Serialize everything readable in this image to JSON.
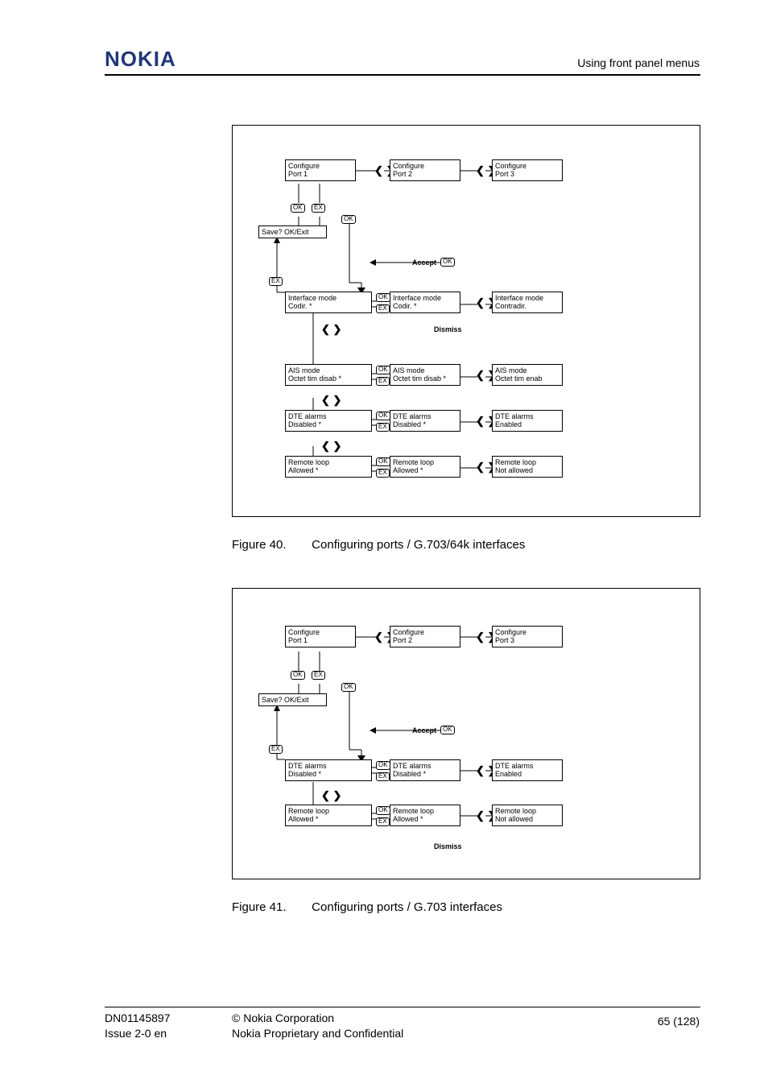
{
  "header": {
    "logo": "NOKIA",
    "section": "Using front panel menus"
  },
  "footer": {
    "doc_no": "DN01145897",
    "issue": "Issue 2-0 en",
    "copyright": "© Nokia Corporation",
    "confidential": "Nokia Proprietary and Confidential",
    "page": "65 (128)"
  },
  "figure40": {
    "caption_num": "Figure 40.",
    "caption_text": "Configuring ports / G.703/64k interfaces",
    "labels": {
      "ok": "OK",
      "ex": "EX",
      "accept": "Accept",
      "dismiss": "Dismiss",
      "save": "Save? OK/Exit",
      "lr": "❮ ❯"
    },
    "chart_data": {
      "type": "table",
      "title": "Menu navigation for G.703/64k port configuration",
      "rows": [
        {
          "row": "ports",
          "col1": "Configure\nPort 1",
          "col2": "Configure\nPort 2",
          "col3": "Configure\nPort 3"
        },
        {
          "row": "iface",
          "col1": "Interface mode\nCodir.       *",
          "col2": "Interface mode\nCodir.       *",
          "col3": "Interface mode\nContradir."
        },
        {
          "row": "ais",
          "col1": "AIS mode\nOctet tim disab  *",
          "col2": "AIS mode\nOctet tim disab  *",
          "col3": "AIS mode\nOctet tim enab"
        },
        {
          "row": "dte",
          "col1": "DTE alarms\nDisabled        *",
          "col2": "DTE alarms\nDisabled        *",
          "col3": "DTE alarms\nEnabled"
        },
        {
          "row": "remote",
          "col1": "Remote loop\nAllowed         *",
          "col2": "Remote loop\nAllowed         *",
          "col3": "Remote loop\nNot allowed"
        }
      ]
    }
  },
  "figure41": {
    "caption_num": "Figure 41.",
    "caption_text": "Configuring ports / G.703 interfaces",
    "labels": {
      "ok": "OK",
      "ex": "EX",
      "accept": "Accept",
      "dismiss": "Dismiss",
      "save": "Save? OK/Exit",
      "lr": "❮ ❯"
    },
    "chart_data": {
      "type": "table",
      "title": "Menu navigation for G.703 port configuration",
      "rows": [
        {
          "row": "ports",
          "col1": "Configure\nPort 1",
          "col2": "Configure\nPort 2",
          "col3": "Configure\nPort 3"
        },
        {
          "row": "dte",
          "col1": "DTE alarms\nDisabled        *",
          "col2": "DTE alarms\nDisabled        *",
          "col3": "DTE alarms\nEnabled"
        },
        {
          "row": "remote",
          "col1": "Remote loop\nAllowed         *",
          "col2": "Remote loop\nAllowed         *",
          "col3": "Remote loop\nNot allowed"
        }
      ]
    }
  }
}
